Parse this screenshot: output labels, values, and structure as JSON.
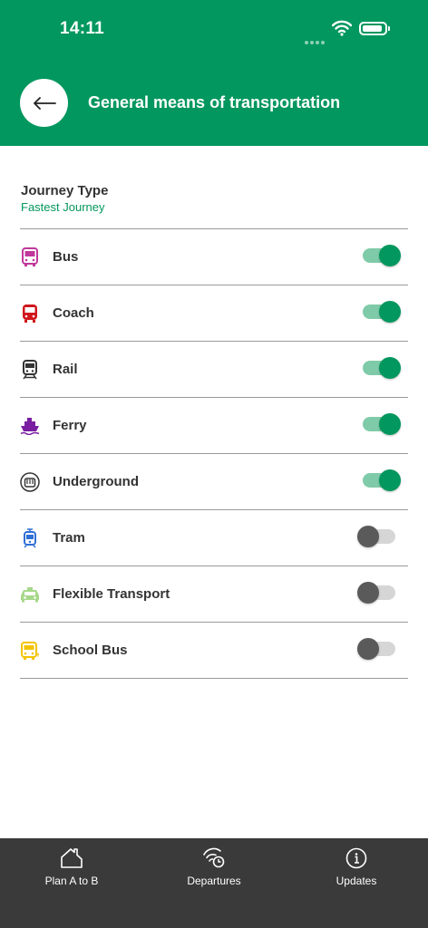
{
  "status_bar": {
    "time": "14:11"
  },
  "header": {
    "title": "General means of transportation"
  },
  "journey": {
    "label": "Journey Type",
    "value": "Fastest Journey"
  },
  "modes": [
    {
      "label": "Bus",
      "enabled": true,
      "icon": "bus-icon",
      "color": "#c0389b"
    },
    {
      "label": "Coach",
      "enabled": true,
      "icon": "coach-icon",
      "color": "#d0161c"
    },
    {
      "label": "Rail",
      "enabled": true,
      "icon": "rail-icon",
      "color": "#333333"
    },
    {
      "label": "Ferry",
      "enabled": true,
      "icon": "ferry-icon",
      "color": "#7a1fa2"
    },
    {
      "label": "Underground",
      "enabled": true,
      "icon": "underground-icon",
      "color": "#333333"
    },
    {
      "label": "Tram",
      "enabled": false,
      "icon": "tram-icon",
      "color": "#2f6fd6"
    },
    {
      "label": "Flexible Transport",
      "enabled": false,
      "icon": "flexible-transport-icon",
      "color": "#a6d88a"
    },
    {
      "label": "School Bus",
      "enabled": false,
      "icon": "school-bus-icon",
      "color": "#f2c400"
    }
  ],
  "tabs": [
    {
      "label": "Plan A to B",
      "icon": "home-icon"
    },
    {
      "label": "Departures",
      "icon": "departures-icon"
    },
    {
      "label": "Updates",
      "icon": "info-icon"
    }
  ],
  "colors": {
    "brand": "#02975e",
    "tabbar": "#3a3a3a"
  }
}
